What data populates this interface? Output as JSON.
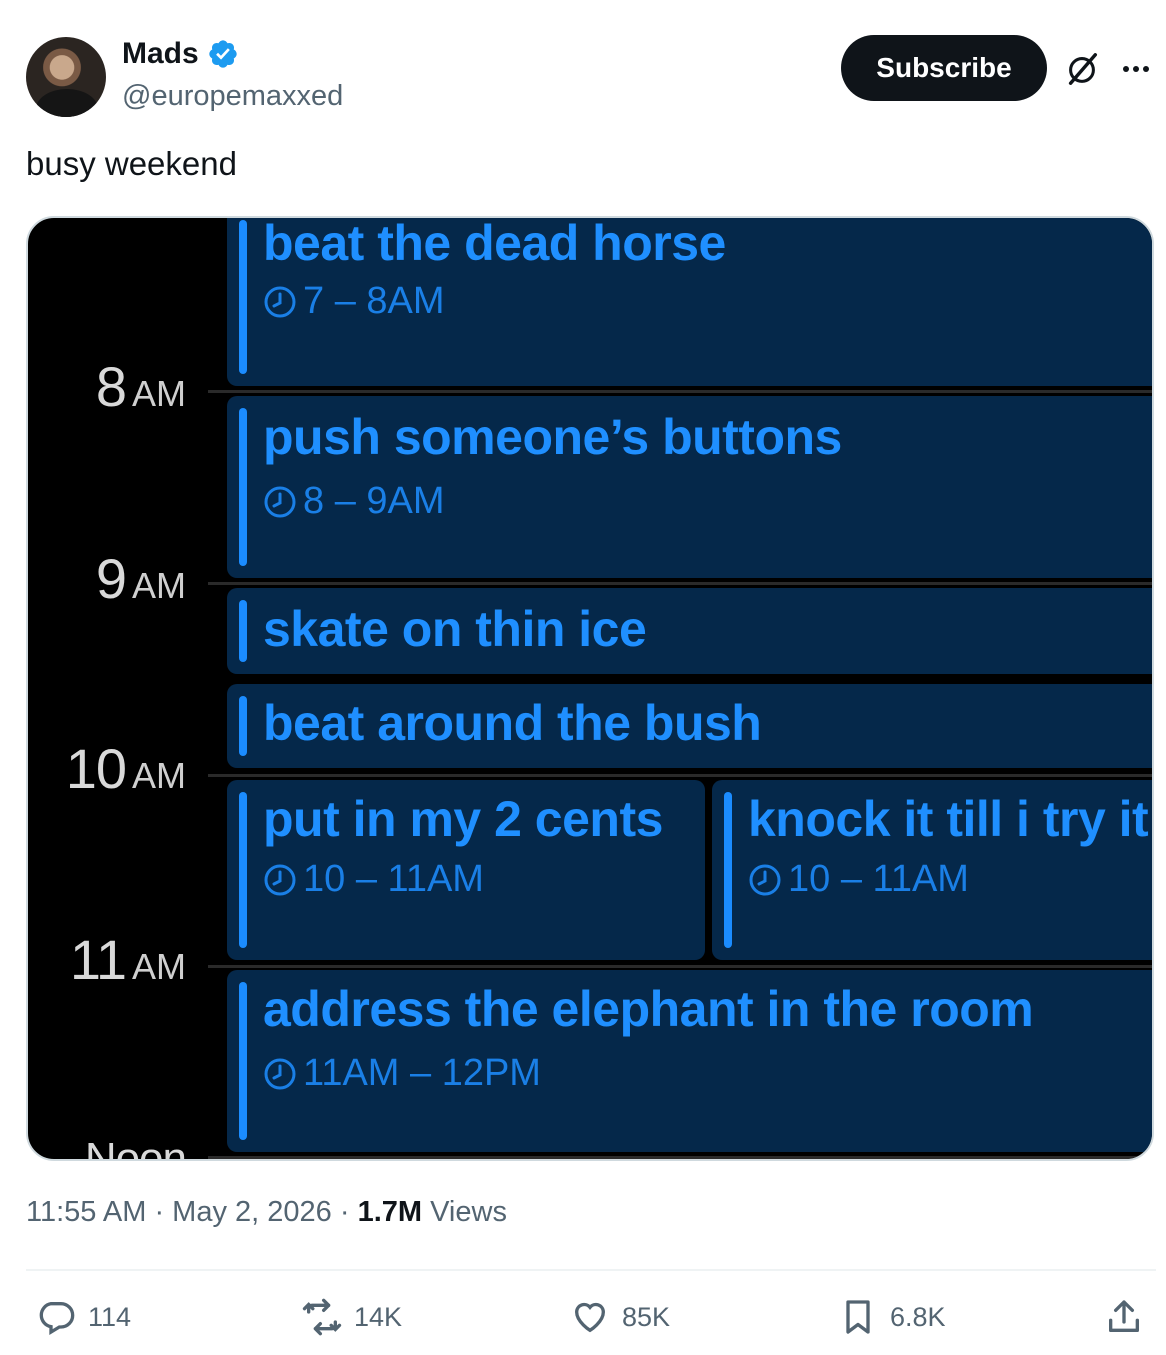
{
  "author": {
    "display_name": "Mads",
    "handle": "@europemaxxed"
  },
  "header": {
    "subscribe_label": "Subscribe"
  },
  "tweet": {
    "text": "busy weekend"
  },
  "calendar": {
    "hours": [
      {
        "num": "8",
        "suffix": "AM"
      },
      {
        "num": "9",
        "suffix": "AM"
      },
      {
        "num": "10",
        "suffix": "AM"
      },
      {
        "num": "11",
        "suffix": "AM"
      },
      {
        "num": "Noon",
        "suffix": ""
      }
    ],
    "events": [
      {
        "title": "beat the dead horse",
        "time": "7 – 8AM"
      },
      {
        "title": "push someone’s buttons",
        "time": "8 – 9AM"
      },
      {
        "title": "skate on thin ice",
        "time": ""
      },
      {
        "title": "beat around the bush",
        "time": ""
      },
      {
        "title": "put in my 2 cents",
        "time": "10 – 11AM"
      },
      {
        "title": "knock it till i try it",
        "time": "10 – 11AM"
      },
      {
        "title": "address the elephant in the room",
        "time": "11AM – 12PM"
      }
    ],
    "colors": {
      "event_bg": "#05284a",
      "accent": "#1b8cff"
    }
  },
  "meta": {
    "time": "11:55 AM",
    "date": "May 2, 2026",
    "views_count": "1.7M",
    "views_label": "Views"
  },
  "actions": {
    "replies": "114",
    "reposts": "14K",
    "likes": "85K",
    "bookmarks": "6.8K"
  }
}
